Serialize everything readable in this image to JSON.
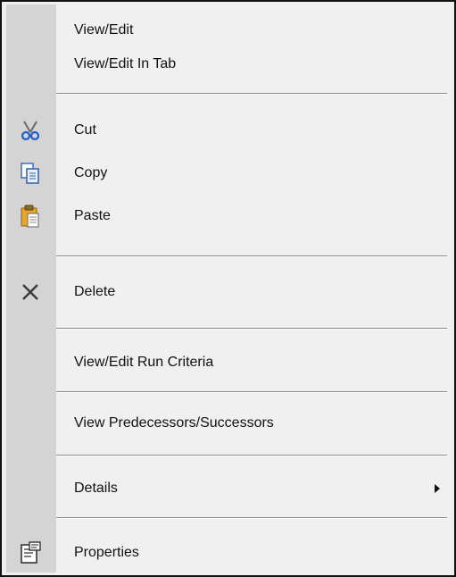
{
  "menu": {
    "items": {
      "view_edit": "View/Edit",
      "view_edit_in_tab": "View/Edit In Tab",
      "cut": "Cut",
      "copy": "Copy",
      "paste": "Paste",
      "delete": "Delete",
      "view_edit_run_criteria": "View/Edit Run Criteria",
      "view_predecessors_successors": "View Predecessors/Successors",
      "details": "Details",
      "properties": "Properties"
    },
    "icons": {
      "cut": "scissors-icon",
      "copy": "copy-icon",
      "paste": "paste-icon",
      "delete": "delete-x-icon",
      "properties": "properties-icon",
      "details": "submenu-arrow-icon"
    }
  }
}
